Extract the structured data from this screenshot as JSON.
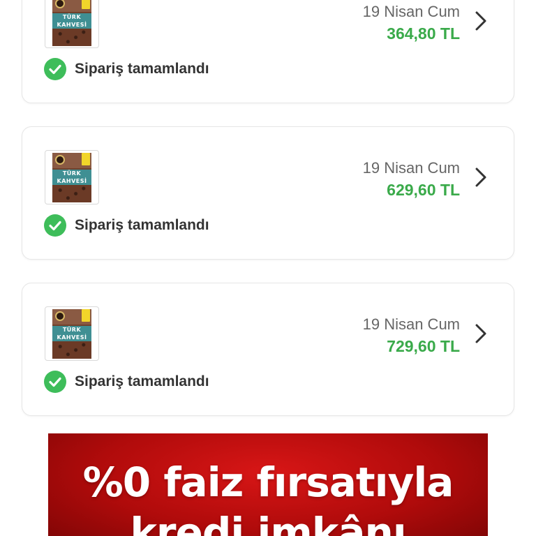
{
  "orders": [
    {
      "date": "19 Nisan Cum",
      "price": "364,80 TL",
      "status": "Sipariş tamamlandı",
      "product": {
        "line1": "TÜRK",
        "line2": "KAHVESİ"
      }
    },
    {
      "date": "19 Nisan Cum",
      "price": "629,60 TL",
      "status": "Sipariş tamamlandı",
      "product": {
        "line1": "TÜRK",
        "line2": "KAHVESİ"
      }
    },
    {
      "date": "19 Nisan Cum",
      "price": "729,60 TL",
      "status": "Sipariş tamamlandı",
      "product": {
        "line1": "TÜRK",
        "line2": "KAHVESİ"
      }
    }
  ],
  "banner": {
    "line1": "%0 faiz fırsatıyla",
    "line2": "kredi imkânı"
  },
  "icons": {
    "status": "check-circle-icon",
    "navigate": "chevron-right-icon"
  },
  "colors": {
    "price": "#3aaa4a",
    "status_check": "#3ebd5a",
    "banner_bg": "#c10f0f"
  }
}
